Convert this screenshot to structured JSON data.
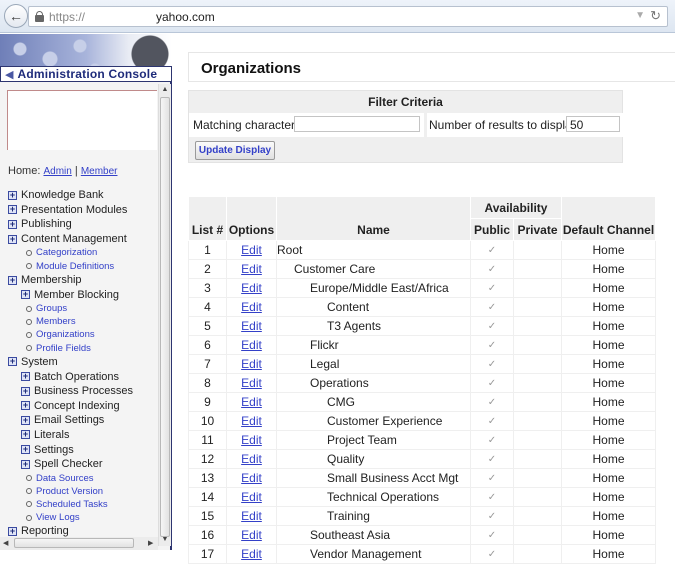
{
  "browser": {
    "url_scheme": "https://",
    "url_host": "yahoo.com",
    "back_icon": "←",
    "dropdown_icon": "▼",
    "reload_icon": "↻"
  },
  "sidebar": {
    "console_title": "Administration Console",
    "console_arrow": "◀",
    "home_label": "Home:",
    "home_links": [
      "Admin",
      "Member"
    ],
    "home_sep": "|",
    "items": [
      {
        "type": "group",
        "level": 1,
        "label": "Knowledge Bank"
      },
      {
        "type": "group",
        "level": 1,
        "label": "Presentation Modules"
      },
      {
        "type": "group",
        "level": 1,
        "label": "Publishing"
      },
      {
        "type": "group",
        "level": 1,
        "label": "Content Management"
      },
      {
        "type": "link",
        "level": 1,
        "label": "Categorization"
      },
      {
        "type": "link",
        "level": 1,
        "label": "Module Definitions"
      },
      {
        "type": "group",
        "level": 1,
        "label": "Membership"
      },
      {
        "type": "group",
        "level": 2,
        "label": "Member Blocking"
      },
      {
        "type": "link",
        "level": 2,
        "label": "Groups"
      },
      {
        "type": "link",
        "level": 2,
        "label": "Members"
      },
      {
        "type": "link",
        "level": 2,
        "label": "Organizations"
      },
      {
        "type": "link",
        "level": 2,
        "label": "Profile Fields"
      },
      {
        "type": "group",
        "level": 1,
        "label": "System"
      },
      {
        "type": "group",
        "level": 2,
        "label": "Batch Operations"
      },
      {
        "type": "group",
        "level": 2,
        "label": "Business Processes"
      },
      {
        "type": "group",
        "level": 2,
        "label": "Concept Indexing"
      },
      {
        "type": "group",
        "level": 2,
        "label": "Email Settings"
      },
      {
        "type": "group",
        "level": 2,
        "label": "Literals"
      },
      {
        "type": "group",
        "level": 2,
        "label": "Settings"
      },
      {
        "type": "group",
        "level": 2,
        "label": "Spell Checker"
      },
      {
        "type": "link",
        "level": 2,
        "label": "Data Sources"
      },
      {
        "type": "link",
        "level": 2,
        "label": "Product Version"
      },
      {
        "type": "link",
        "level": 2,
        "label": "Scheduled Tasks"
      },
      {
        "type": "link",
        "level": 2,
        "label": "View Logs"
      },
      {
        "type": "group",
        "level": 1,
        "label": "Reporting"
      }
    ]
  },
  "main": {
    "title": "Organizations",
    "filter": {
      "heading": "Filter Criteria",
      "matching_label": "Matching characters",
      "matching_value": "",
      "results_label": "Number of results to display",
      "results_value": "50",
      "update_button": "Update Display"
    },
    "table": {
      "headers": {
        "list": "List #",
        "options": "Options",
        "name": "Name",
        "availability": "Availability",
        "public": "Public",
        "private": "Private",
        "channel": "Default Channel"
      },
      "rows": [
        {
          "num": "1",
          "option": "Edit",
          "name": "Root",
          "level": 0,
          "public": "✓",
          "private": "",
          "channel": "Home"
        },
        {
          "num": "2",
          "option": "Edit",
          "name": "Customer Care",
          "level": 1,
          "public": "✓",
          "private": "",
          "channel": "Home"
        },
        {
          "num": "3",
          "option": "Edit",
          "name": "Europe/Middle East/Africa",
          "level": 2,
          "public": "✓",
          "private": "",
          "channel": "Home"
        },
        {
          "num": "4",
          "option": "Edit",
          "name": "Content",
          "level": 3,
          "public": "✓",
          "private": "",
          "channel": "Home"
        },
        {
          "num": "5",
          "option": "Edit",
          "name": "T3 Agents",
          "level": 3,
          "public": "✓",
          "private": "",
          "channel": "Home"
        },
        {
          "num": "6",
          "option": "Edit",
          "name": "Flickr",
          "level": 2,
          "public": "✓",
          "private": "",
          "channel": "Home"
        },
        {
          "num": "7",
          "option": "Edit",
          "name": "Legal",
          "level": 2,
          "public": "✓",
          "private": "",
          "channel": "Home"
        },
        {
          "num": "8",
          "option": "Edit",
          "name": "Operations",
          "level": 2,
          "public": "✓",
          "private": "",
          "channel": "Home"
        },
        {
          "num": "9",
          "option": "Edit",
          "name": "CMG",
          "level": 3,
          "public": "✓",
          "private": "",
          "channel": "Home"
        },
        {
          "num": "10",
          "option": "Edit",
          "name": "Customer Experience",
          "level": 3,
          "public": "✓",
          "private": "",
          "channel": "Home"
        },
        {
          "num": "11",
          "option": "Edit",
          "name": "Project Team",
          "level": 3,
          "public": "✓",
          "private": "",
          "channel": "Home"
        },
        {
          "num": "12",
          "option": "Edit",
          "name": "Quality",
          "level": 3,
          "public": "✓",
          "private": "",
          "channel": "Home"
        },
        {
          "num": "13",
          "option": "Edit",
          "name": "Small Business Acct Mgt",
          "level": 3,
          "public": "✓",
          "private": "",
          "channel": "Home"
        },
        {
          "num": "14",
          "option": "Edit",
          "name": "Technical Operations",
          "level": 3,
          "public": "✓",
          "private": "",
          "channel": "Home"
        },
        {
          "num": "15",
          "option": "Edit",
          "name": "Training",
          "level": 3,
          "public": "✓",
          "private": "",
          "channel": "Home"
        },
        {
          "num": "16",
          "option": "Edit",
          "name": "Southeast Asia",
          "level": 2,
          "public": "✓",
          "private": "",
          "channel": "Home"
        },
        {
          "num": "17",
          "option": "Edit",
          "name": "Vendor Management",
          "level": 2,
          "public": "✓",
          "private": "",
          "channel": "Home"
        }
      ]
    }
  }
}
